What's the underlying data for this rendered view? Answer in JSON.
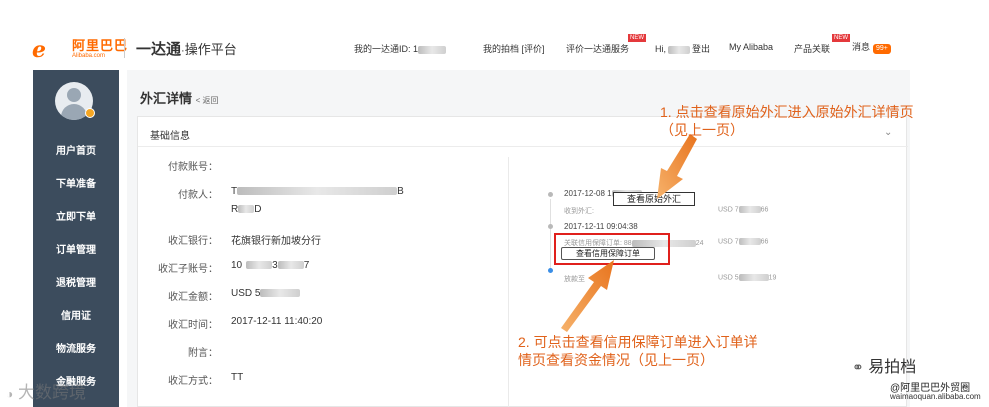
{
  "header": {
    "logo_cn": "阿里巴巴",
    "logo_en": "Alibaba.com",
    "brand_main": "一达通",
    "brand_sep": "·",
    "brand_sub": "操作平台",
    "my_id_label": "我的一达通ID: 1",
    "my_rating": "我的拍档 [评价]",
    "rate_service": "评价一达通服务",
    "new_badge": "NEW",
    "hi": "Hi,",
    "logout": "登出",
    "my_alibaba": "My Alibaba",
    "product_link": "产品关联",
    "messages": "消息",
    "message_count": "99+"
  },
  "sidebar": {
    "items": [
      {
        "label": "用户首页"
      },
      {
        "label": "下单准备"
      },
      {
        "label": "立即下单"
      },
      {
        "label": "订单管理"
      },
      {
        "label": "退税管理"
      },
      {
        "label": "信用证"
      },
      {
        "label": "物流服务"
      },
      {
        "label": "金融服务"
      }
    ]
  },
  "main": {
    "title": "外汇详情",
    "back_link": "< 返回",
    "section_title": "基础信息",
    "collapse_icon": "chevron-down-icon",
    "fields": [
      {
        "label": "付款账号：",
        "value": ""
      },
      {
        "label": "付款人：",
        "value": "T",
        "value2": "B"
      },
      {
        "label": "",
        "value": "R",
        "value2": "D"
      },
      {
        "label": "收汇银行：",
        "value": "花旗银行新加坡分行"
      },
      {
        "label": "收汇子账号：",
        "value": "10",
        "value2": "3",
        "value3": "7"
      },
      {
        "label": "收汇金额：",
        "value": "USD 5"
      },
      {
        "label": "收汇时间：",
        "value": "2017-12-11 11:40:20"
      },
      {
        "label": "附言：",
        "value": ""
      },
      {
        "label": "收汇方式：",
        "value": "TT"
      }
    ],
    "timeline": [
      {
        "time": "2017-12-08 1",
        "sub": "收到外汇:",
        "amount": "USD 7",
        "amount_end": "66"
      },
      {
        "time": "2017-12-11 09:04:38",
        "sub": "关联信用保障订单: 88",
        "sub_end": "24",
        "amount": "USD 7",
        "amount_end": "66"
      },
      {
        "time": "",
        "sub": "放款至",
        "sub_end": "",
        "amount": "USD 5",
        "amount_end": "19"
      }
    ],
    "view_original_button": "查看原始外汇",
    "view_credit_button": "查看信用保障订单"
  },
  "annotations": {
    "note1_line1": "1. 点击查看原始外汇进入原始外汇详情页",
    "note1_line2": "（见上一页）",
    "note2_line1": "2. 可点击查看信用保障订单进入订单详",
    "note2_line2": "情页查看资金情况（见上一页）",
    "arrow_color": "#f08a24",
    "highlight_color": "#e0201c"
  },
  "watermarks": {
    "left": "大数跨境",
    "wechat": "易拍档",
    "account": "@阿里巴巴外贸圈",
    "site": "waimaoquan.alibaba.com"
  },
  "colors": {
    "brand_orange": "#ff6a00",
    "sidebar_bg": "#3c4c5d",
    "annotation_text": "#e0621b"
  }
}
